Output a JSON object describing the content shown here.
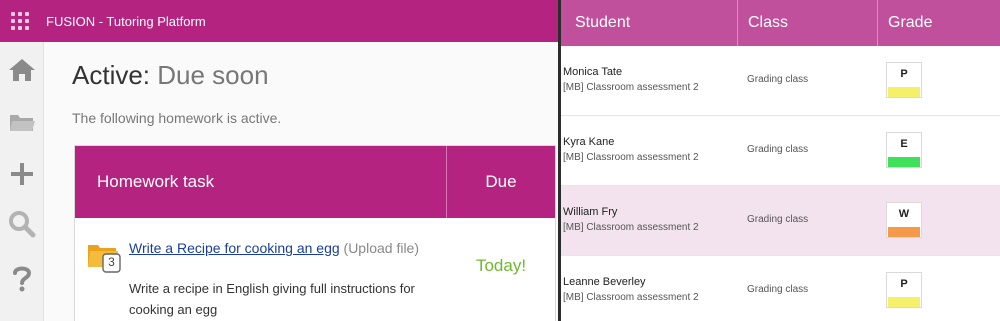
{
  "app": {
    "title": "FUSION - Tutoring Platform"
  },
  "sidebar": {
    "items": [
      {
        "icon": "home-icon"
      },
      {
        "icon": "folder-icon"
      },
      {
        "icon": "plus-icon"
      },
      {
        "icon": "search-icon"
      },
      {
        "icon": "help-icon"
      }
    ]
  },
  "page": {
    "title_prefix": "Active:",
    "title_status": "Due soon",
    "subtitle": "The following homework is active."
  },
  "homework_table": {
    "headers": {
      "task": "Homework task",
      "due": "Due"
    },
    "rows": [
      {
        "icon": "folder-icon",
        "badge": "3",
        "title": "Write a Recipe for cooking an egg",
        "type": "(Upload file)",
        "description": "Write a recipe in English giving full instructions for cooking an egg",
        "due": "Today!"
      }
    ]
  },
  "grades_table": {
    "headers": {
      "student": "Student",
      "class": "Class",
      "grade": "Grade"
    },
    "rows": [
      {
        "student": "Monica Tate",
        "assessment": "[MB] Classroom assessment 2",
        "class": "Grading class",
        "grade": "P",
        "grade_color": "#f5f06a"
      },
      {
        "student": "Kyra Kane",
        "assessment": "[MB] Classroom assessment 2",
        "class": "Grading class",
        "grade": "E",
        "grade_color": "#3fe05a"
      },
      {
        "student": "William Fry",
        "assessment": "[MB] Classroom assessment 2",
        "class": "Grading class",
        "grade": "W",
        "grade_color": "#f59a4a"
      },
      {
        "student": "Leanne Beverley",
        "assessment": "[MB] Classroom assessment 2",
        "class": "Grading class",
        "grade": "P",
        "grade_color": "#f5f06a"
      }
    ]
  },
  "colors": {
    "brand": "#b3237f",
    "header_right": "#c1509c",
    "due_text": "#6fb82d",
    "link": "#1a3e9e"
  }
}
